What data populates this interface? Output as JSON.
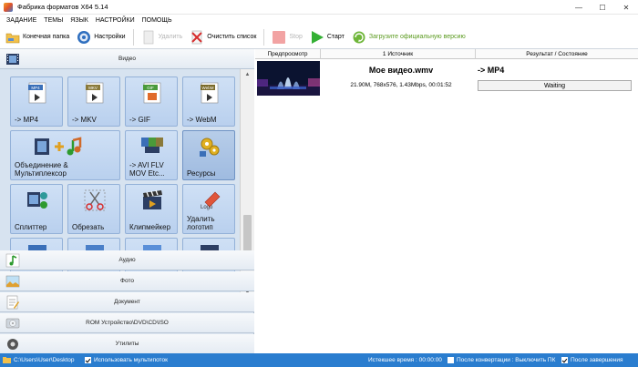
{
  "window": {
    "title": "Фабрика форматов X64 5.14",
    "controls": {
      "minimize": "—",
      "maximize": "☐",
      "close": "✕"
    }
  },
  "menu": [
    "ЗАДАНИЕ",
    "ТЕМЫ",
    "ЯЗЫК",
    "НАСТРОЙКИ",
    "ПОМОЩЬ"
  ],
  "toolbar": {
    "output_folder": "Конечная папка",
    "settings": "Настройки",
    "remove": "Удалить",
    "clear_list": "Очистить список",
    "stop": "Stop",
    "start": "Старт",
    "upgrade": "Загрузите официальную версию"
  },
  "left_panel": {
    "video_label": "Видео",
    "tiles": [
      {
        "label": "-> MP4",
        "badge": "MP4"
      },
      {
        "label": "-> MKV",
        "badge": "MKV"
      },
      {
        "label": "-> GIF",
        "badge": "GIF"
      },
      {
        "label": "-> WebM",
        "badge": "WebM"
      },
      {
        "label": "Объединение & Мультиплексор"
      },
      {
        "label": "-> AVI FLV MOV Etc..."
      },
      {
        "label": "Ресурсы"
      },
      {
        "label": ""
      },
      {
        "label": "Сплиттер"
      },
      {
        "label": "Обрезать"
      },
      {
        "label": "Клипмейкер"
      },
      {
        "label": "Удалить логотип",
        "badge": "Logo"
      }
    ],
    "categories": {
      "audio": "Аудио",
      "photo": "Фото",
      "document": "Документ",
      "rom": "ROM Устройство\\DVD\\CD\\ISO",
      "utilities": "Утилиты"
    }
  },
  "job_table": {
    "headers": {
      "preview": "Предпросмотр",
      "source": "1 Источник",
      "result": "Результат / Состояние"
    },
    "jobs": [
      {
        "name": "Мое видео.wmv",
        "info": "21.90M, 768x576, 1.43Mbps, 00:01:52",
        "target": "-> MP4",
        "status": "Waiting"
      }
    ]
  },
  "status_bar": {
    "path": "C:\\Users\\User\\Desktop",
    "multithread": "Использовать мультипоток",
    "elapsed": "Истекшее время : 00:00:00",
    "after_convert": "После конвертации : Выключить ПК",
    "after_finish": "После завершения"
  },
  "colors": {
    "accent": "#2a7dcf",
    "panel": "#dfe8f2",
    "tile": "#c3d7f1"
  }
}
